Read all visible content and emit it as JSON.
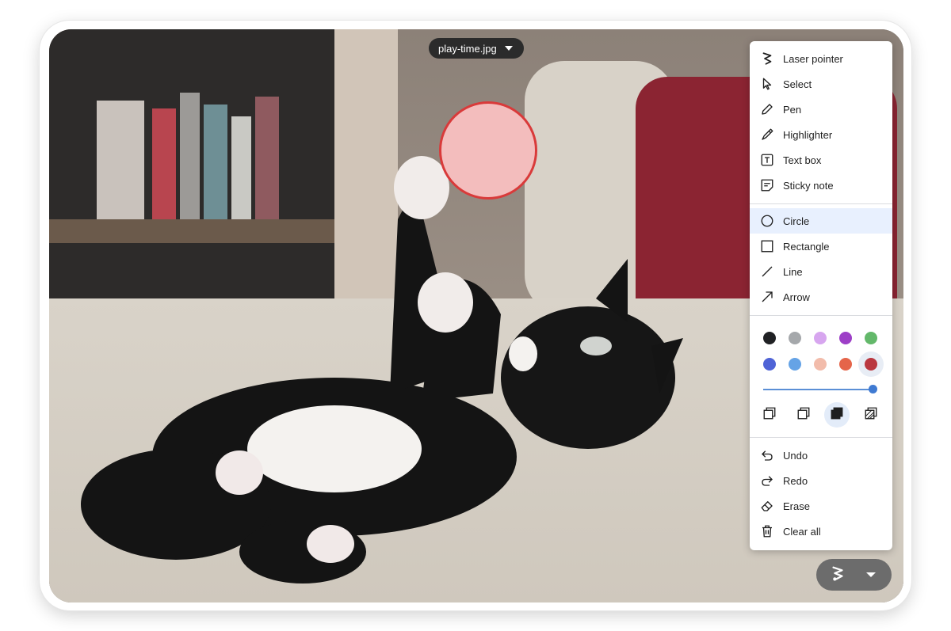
{
  "file": {
    "name": "play-time.jpg"
  },
  "tools": [
    {
      "id": "laser",
      "label": "Laser pointer",
      "icon": "laser-pointer-icon"
    },
    {
      "id": "select",
      "label": "Select",
      "icon": "cursor-icon"
    },
    {
      "id": "pen",
      "label": "Pen",
      "icon": "pen-icon"
    },
    {
      "id": "highlighter",
      "label": "Highlighter",
      "icon": "highlighter-icon"
    },
    {
      "id": "textbox",
      "label": "Text box",
      "icon": "text-box-icon"
    },
    {
      "id": "sticky",
      "label": "Sticky note",
      "icon": "sticky-note-icon"
    }
  ],
  "shapes": [
    {
      "id": "circle",
      "label": "Circle",
      "icon": "circle-icon",
      "active": true
    },
    {
      "id": "rectangle",
      "label": "Rectangle",
      "icon": "rectangle-icon"
    },
    {
      "id": "line",
      "label": "Line",
      "icon": "line-icon"
    },
    {
      "id": "arrow",
      "label": "Arrow",
      "icon": "arrow-icon"
    }
  ],
  "colors": {
    "row1": [
      "#202124",
      "#a5a8ab",
      "#d7a6ef",
      "#9d3fc7",
      "#63b86a"
    ],
    "row2": [
      "#4f63d6",
      "#65a3e6",
      "#f2bcab",
      "#e5654a",
      "#cc3636"
    ],
    "selected": "#cc3636"
  },
  "stroke_width": {
    "level": 1.0
  },
  "layers": {
    "icons": [
      "bring-to-front-icon",
      "send-to-back-icon",
      "fill-solid-icon",
      "fill-hatch-icon"
    ],
    "selected": "fill-solid-icon"
  },
  "actions": [
    {
      "id": "undo",
      "label": "Undo",
      "icon": "undo-icon"
    },
    {
      "id": "redo",
      "label": "Redo",
      "icon": "redo-icon"
    },
    {
      "id": "erase",
      "label": "Erase",
      "icon": "eraser-icon"
    },
    {
      "id": "clear",
      "label": "Clear all",
      "icon": "trash-icon"
    }
  ],
  "annotation": {
    "shape": "circle",
    "fill": "#f3bdbd",
    "stroke": "#d93a3a"
  },
  "fab": {
    "icon": "laser-pointer-icon"
  }
}
